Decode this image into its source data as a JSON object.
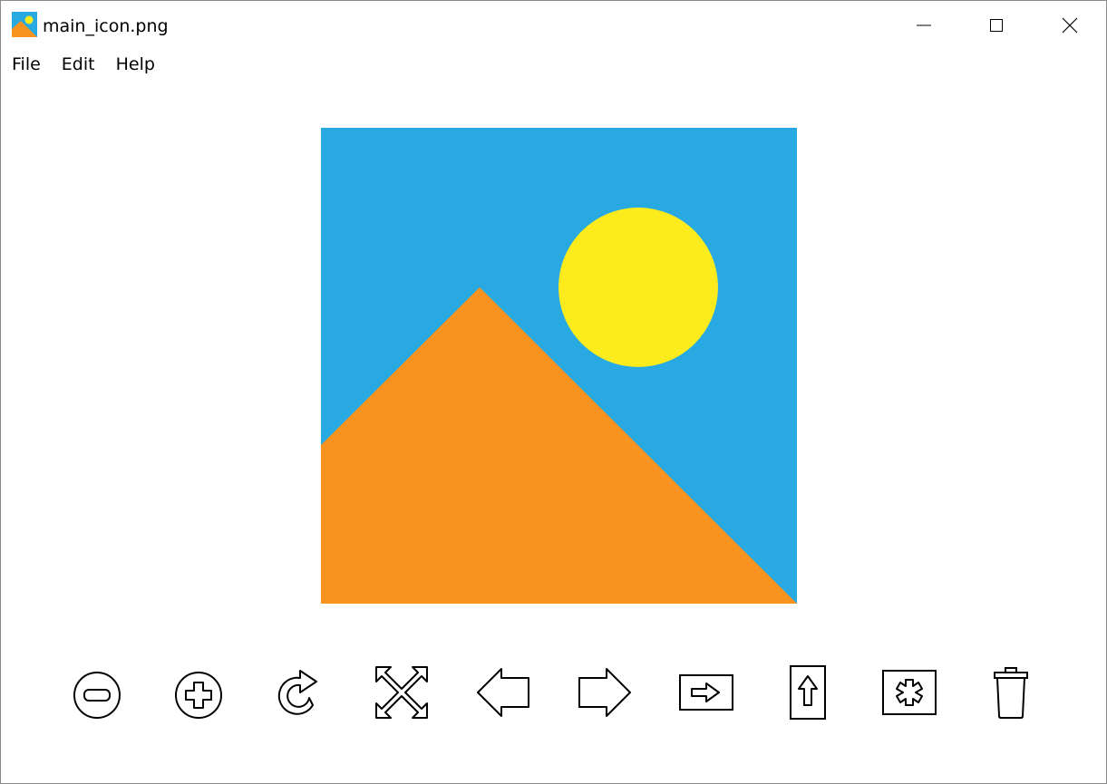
{
  "window": {
    "title": "main_icon.png",
    "icon": "image-icon"
  },
  "menu": {
    "items": [
      {
        "label": "File"
      },
      {
        "label": "Edit"
      },
      {
        "label": "Help"
      }
    ]
  },
  "image": {
    "sky_color": "#29a9e1",
    "sun_color": "#fcec1e",
    "mountain_color": "#f7931e"
  },
  "toolbar": {
    "buttons": [
      {
        "icon": "zoom-out-icon"
      },
      {
        "icon": "zoom-in-icon"
      },
      {
        "icon": "rotate-icon"
      },
      {
        "icon": "fit-to-window-icon"
      },
      {
        "icon": "previous-arrow-icon"
      },
      {
        "icon": "next-arrow-icon"
      },
      {
        "icon": "export-icon"
      },
      {
        "icon": "upload-icon"
      },
      {
        "icon": "effects-icon"
      },
      {
        "icon": "trash-icon"
      }
    ]
  }
}
